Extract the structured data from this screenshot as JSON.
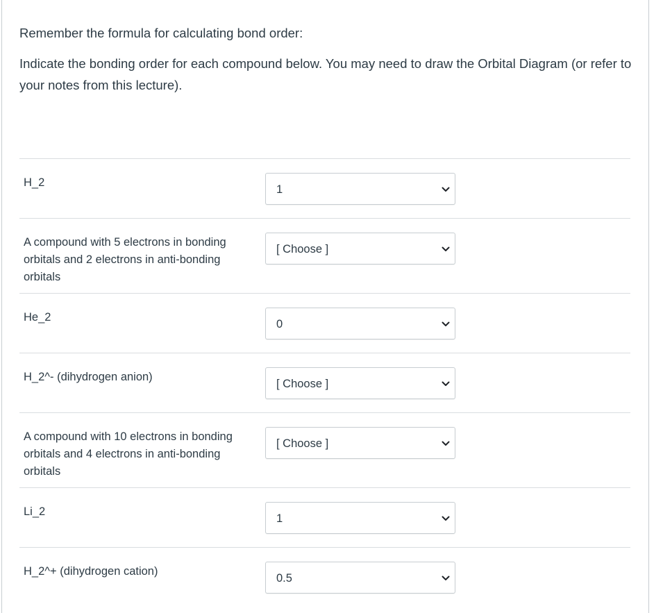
{
  "intro": {
    "line1": "Remember the formula for calculating bond order:",
    "line2": "Indicate the bonding order for each compound below. You may need to draw the Orbital Diagram (or refer to your notes from this lecture)."
  },
  "questions": [
    {
      "label": "H_2",
      "selected": "1"
    },
    {
      "label": "A compound with 5 electrons in bonding orbitals and 2 electrons in anti-bonding orbitals",
      "selected": "[ Choose ]"
    },
    {
      "label": "He_2",
      "selected": "0"
    },
    {
      "label": "H_2^- (dihydrogen anion)",
      "selected": "[ Choose ]"
    },
    {
      "label": "A compound with 10 electrons in bonding orbitals and 4 electrons in anti-bonding orbitals",
      "selected": "[ Choose ]"
    },
    {
      "label": "Li_2",
      "selected": "1"
    },
    {
      "label": "H_2^+ (dihydrogen cation)",
      "selected": "0.5"
    }
  ],
  "icons": {
    "dropdown": "chevron-down-icon"
  },
  "colors": {
    "text": "#2d3b45",
    "border": "#c7cdd1",
    "divider": "#d9dde0"
  }
}
